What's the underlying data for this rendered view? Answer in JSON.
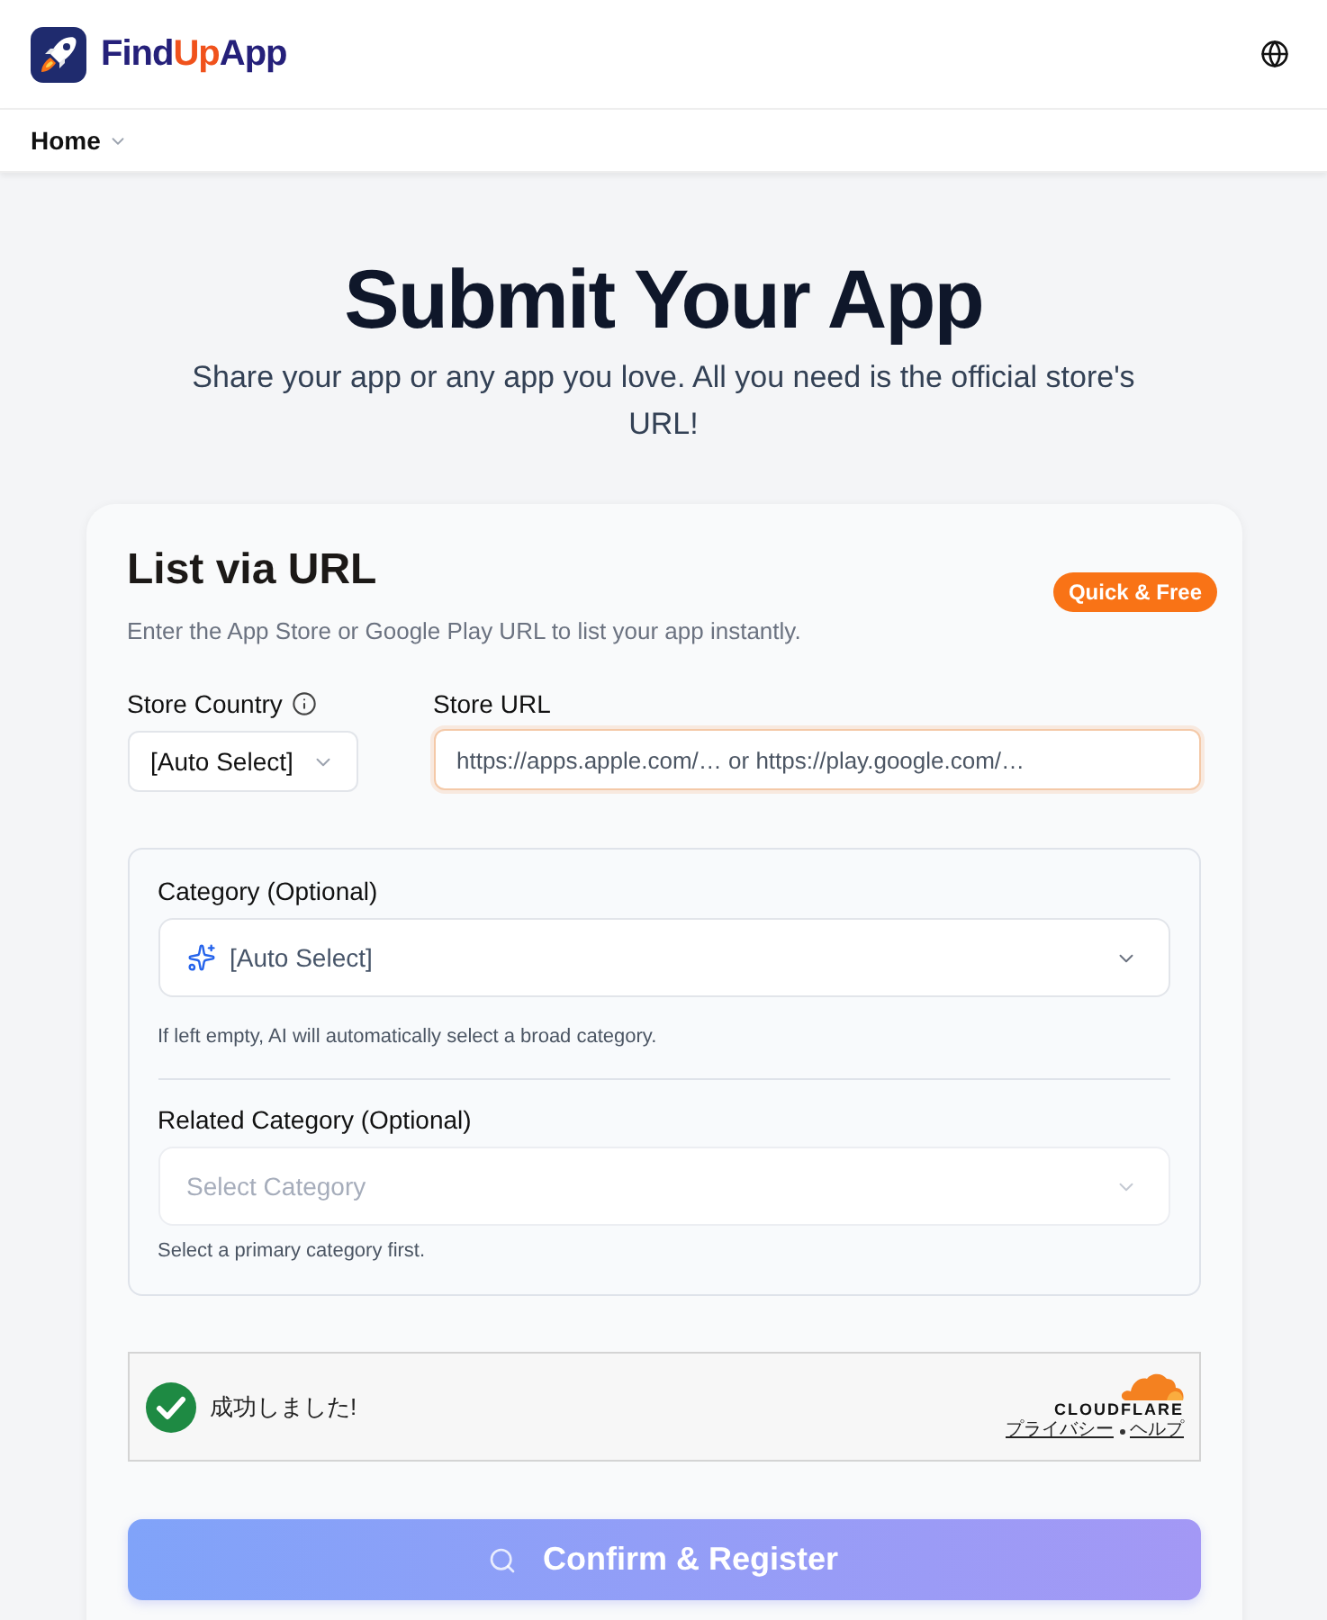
{
  "header": {
    "brand": [
      {
        "text": "Find",
        "color": "#25207a"
      },
      {
        "text": "Up",
        "color": "#f0521c"
      },
      {
        "text": "App",
        "color": "#25207a"
      }
    ]
  },
  "nav": {
    "items": [
      {
        "label": "Home",
        "has_menu": true
      }
    ]
  },
  "hero": {
    "title": "Submit Your App",
    "subtitle": "Share your app or any app you love. All you need is the official store's URL!"
  },
  "card": {
    "title": "List via URL",
    "badge": "Quick & Free",
    "description": "Enter the App Store or Google Play URL to list your app instantly.",
    "store_country": {
      "label": "Store Country",
      "value": "[Auto Select]"
    },
    "store_url": {
      "label": "Store URL",
      "placeholder": "https://apps.apple.com/… or https://play.google.com/…",
      "focused": true
    },
    "category": {
      "label": "Category (Optional)",
      "value": "[Auto Select]",
      "hint": "If left empty, AI will automatically select a broad category."
    },
    "related_category": {
      "label": "Related Category (Optional)",
      "placeholder": "Select Category",
      "disabled": true,
      "hint": "Select a primary category first."
    },
    "captcha": {
      "message": "成功しました!",
      "verified": true,
      "logo": "CLOUDFLARE",
      "links": [
        "プライバシー",
        "ヘルプ"
      ]
    },
    "submit": {
      "label": "Confirm & Register",
      "disabled": true
    }
  }
}
